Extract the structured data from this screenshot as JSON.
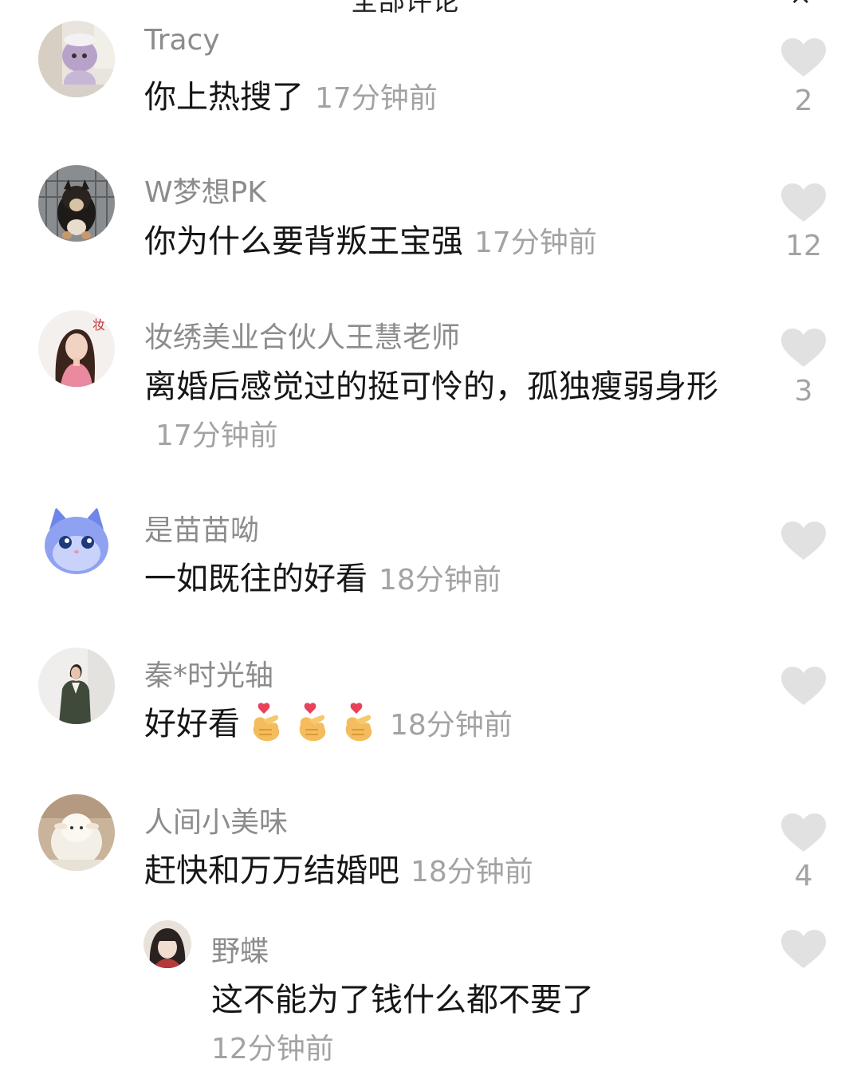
{
  "header": {
    "title_fragment": "全部评论",
    "close_fragment": "×"
  },
  "comments": [
    {
      "username": "Tracy",
      "text": "你上热搜了",
      "time": "17分钟前",
      "likes": "2",
      "avatar": "plush-toy-avatar"
    },
    {
      "username": "W梦想PK",
      "text": "你为什么要背叛王宝强",
      "time": "17分钟前",
      "likes": "12",
      "avatar": "puppy-avatar"
    },
    {
      "username": "妆绣美业合伙人王慧老师",
      "text": "离婚后感觉过的挺可怜的，孤独瘦弱身形",
      "time": "17分钟前",
      "likes": "3",
      "avatar": "woman-avatar"
    },
    {
      "username": "是苗苗呦",
      "text": "一如既往的好看",
      "time": "18分钟前",
      "likes": "",
      "avatar": "cat-avatar"
    },
    {
      "username": "秦*时光轴",
      "text": "好好看",
      "emoji": [
        "heart-hands-emoji",
        "heart-hands-emoji",
        "heart-hands-emoji"
      ],
      "time": "18分钟前",
      "likes": "",
      "avatar": "suit-woman-avatar"
    },
    {
      "username": "人间小美味",
      "text": "赶快和万万结婚吧",
      "time": "18分钟前",
      "likes": "4",
      "avatar": "lamb-toy-avatar"
    }
  ],
  "reply": {
    "username": "野蝶",
    "text": "这不能为了钱什么都不要了",
    "time": "12分钟前",
    "likes": "",
    "avatar": "girl-avatar"
  },
  "colors": {
    "username": "#8c8c8c",
    "text": "#161616",
    "time": "#a3a3a3",
    "heart": "#e1e1e1"
  }
}
